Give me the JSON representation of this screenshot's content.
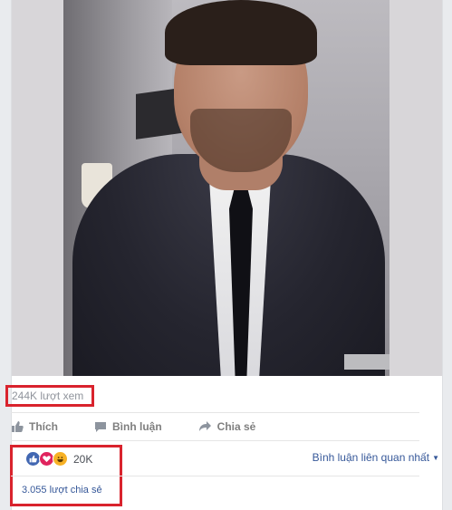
{
  "post": {
    "views_label": "244K lượt xem",
    "actions": {
      "like": "Thích",
      "comment": "Bình luận",
      "share": "Chia sẻ"
    },
    "reactions": {
      "icons": [
        "like-icon",
        "love-icon",
        "haha-icon"
      ],
      "count": "20K"
    },
    "comment_sort": "Bình luận liên quan nhất",
    "shares_label": "3.055 lượt chia sẻ"
  },
  "colors": {
    "highlight": "#d9232d",
    "link": "#365899",
    "like_blue": "#4267b2",
    "love_red": "#e0245e",
    "haha_yellow": "#f7b125"
  }
}
